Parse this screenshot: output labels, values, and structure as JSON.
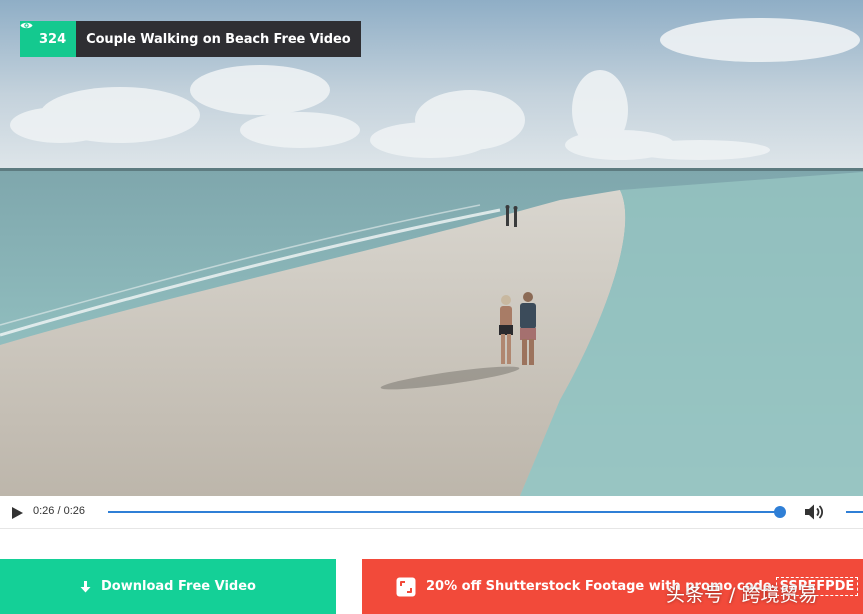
{
  "video": {
    "views": "324",
    "title": "Couple Walking on Beach Free Video"
  },
  "controls": {
    "time": "0:26 / 0:26",
    "progress_fraction": 1.0
  },
  "actions": {
    "download_label": "Download Free Video",
    "promo_label": "20% off Shutterstock Footage with promo code",
    "promo_code": "SSPEFPDE"
  },
  "watermark": "头条号 / 跨境贸易",
  "colors": {
    "accent_green": "#14c98f",
    "download_green": "#14d097",
    "promo_red": "#f24a3a",
    "progress_blue": "#2f7fd6",
    "title_bg": "#2f2f33"
  },
  "icons": {
    "views": "eye-icon",
    "play": "play-icon",
    "volume": "volume-icon",
    "download": "download-arrow-icon",
    "promo": "shutterstock-icon"
  }
}
